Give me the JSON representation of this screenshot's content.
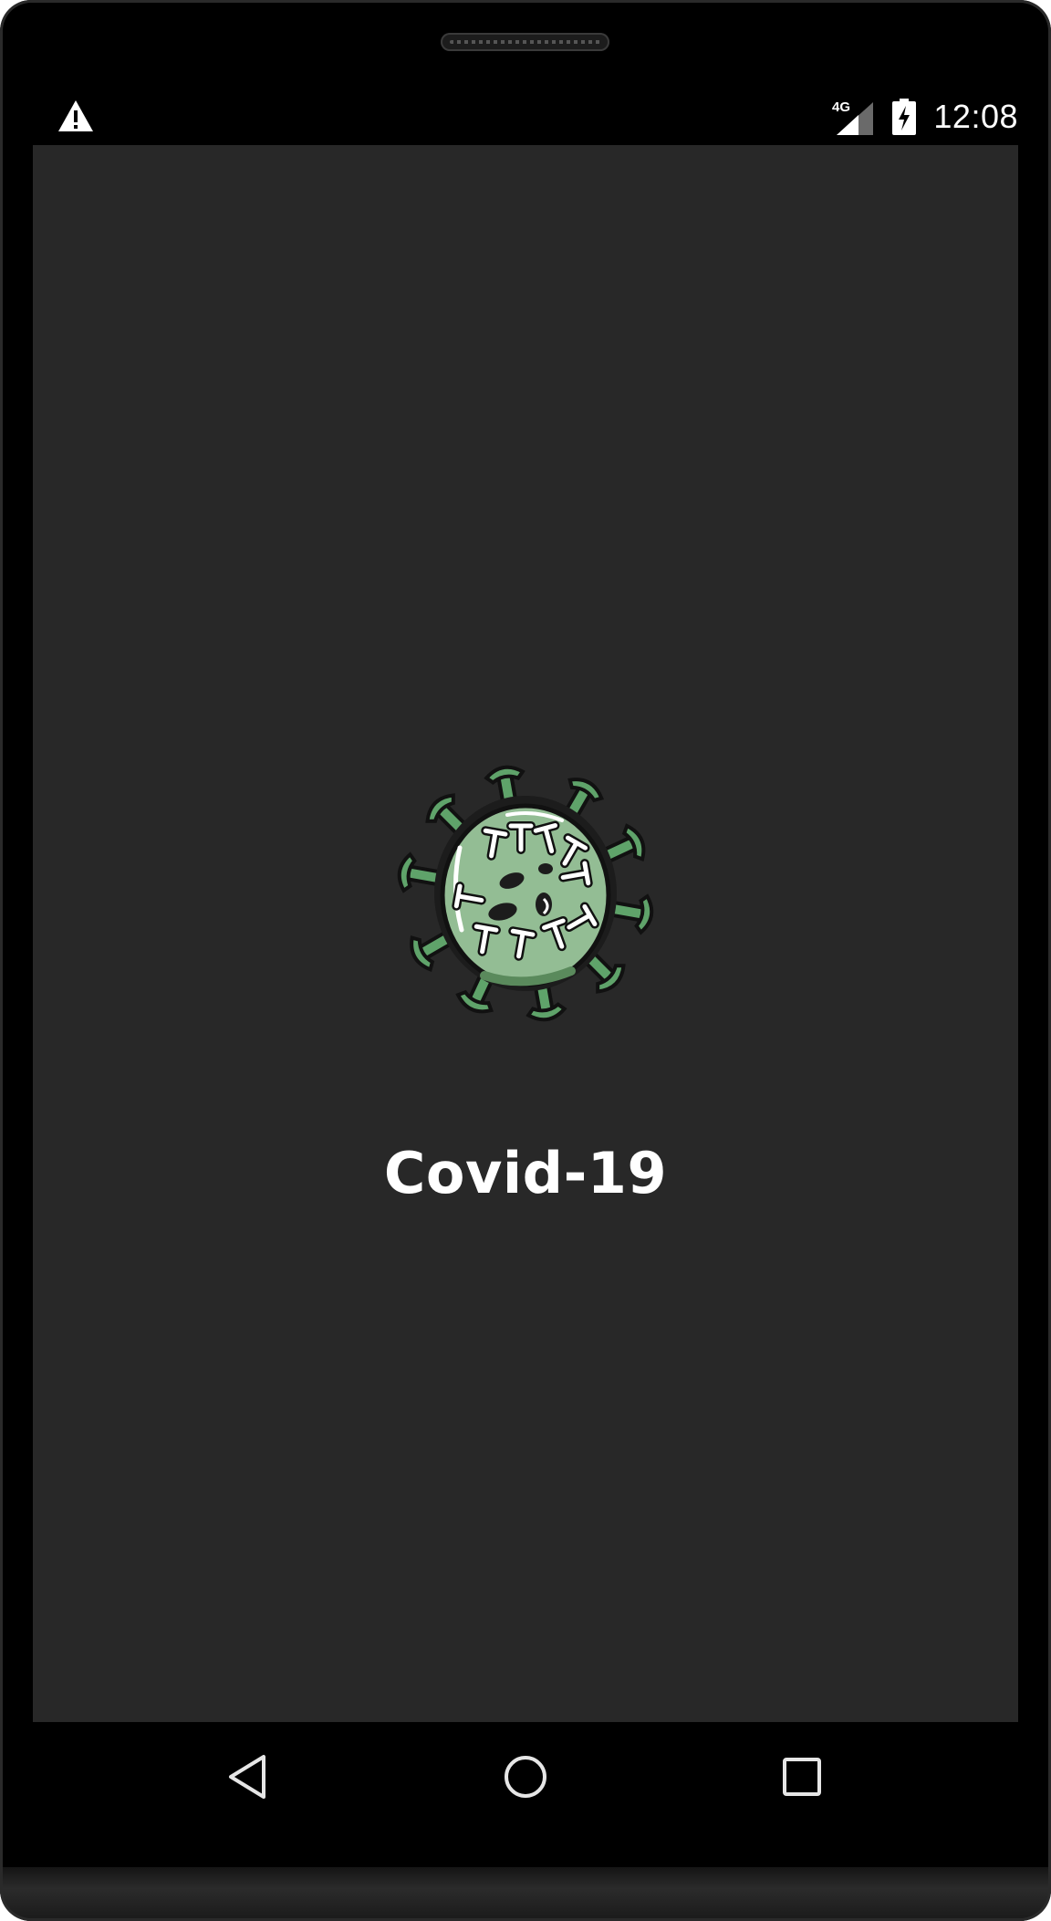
{
  "status_bar": {
    "warning_icon": "warning-triangle-icon",
    "network_label": "4G",
    "network_icon": "cell-signal-icon",
    "battery_icon": "battery-charging-icon",
    "time": "12:08"
  },
  "splash": {
    "logo_icon": "coronavirus-icon",
    "title": "Covid-19",
    "colors": {
      "background": "#282828",
      "virus_body": "#93bd94",
      "virus_spike": "#5fa36a",
      "title": "#ffffff"
    }
  },
  "nav_bar": {
    "back_icon": "back-triangle-icon",
    "home_icon": "home-circle-icon",
    "recents_icon": "recents-square-icon"
  }
}
